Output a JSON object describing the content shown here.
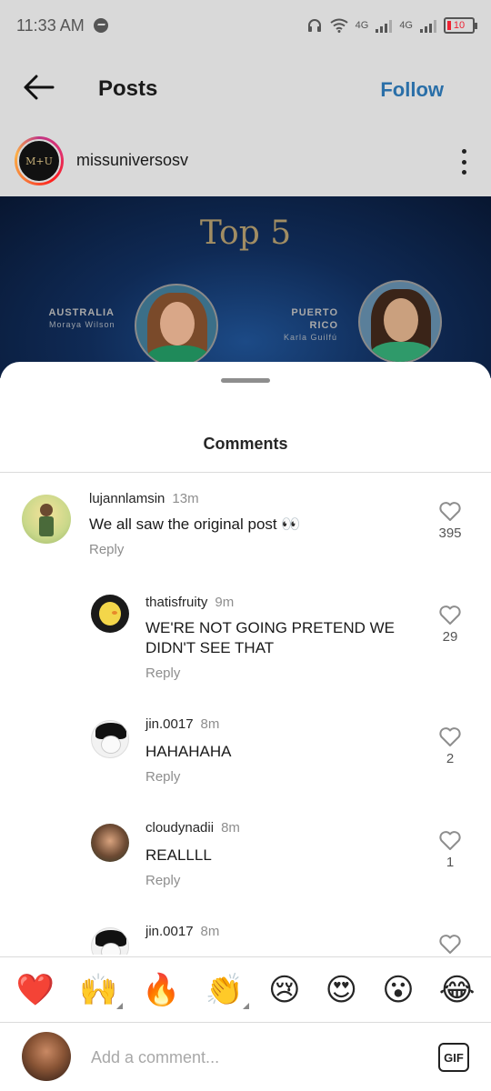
{
  "status_bar": {
    "time": "11:33 AM",
    "network1": "4G",
    "network2": "4G",
    "battery": "10"
  },
  "header": {
    "title": "Posts",
    "follow_label": "Follow"
  },
  "post": {
    "username": "missuniversosv",
    "avatar_text": "M+U",
    "image": {
      "title": "Top 5",
      "left_country": "AUSTRALIA",
      "left_name": "Moraya Wilson",
      "right_country_line1": "PUERTO",
      "right_country_line2": "RICO",
      "right_name": "Karla Guilfú"
    }
  },
  "comments_sheet": {
    "title": "Comments",
    "comments": [
      {
        "user": "lujannlamsin",
        "time": "13m",
        "text": "We all saw the original post 👀",
        "reply_label": "Reply",
        "likes": "395"
      },
      {
        "user": "thatisfruity",
        "time": "9m",
        "text_line1": "WE'RE NOT GOING PRETEND WE",
        "text_line2": "DIDN'T SEE THAT",
        "reply_label": "Reply",
        "likes": "29"
      },
      {
        "user": "jin.0017",
        "time": "8m",
        "text": "HAHAHAHA",
        "reply_label": "Reply",
        "likes": "2"
      },
      {
        "user": "cloudynadii",
        "time": "8m",
        "text": "REALLLL",
        "reply_label": "Reply",
        "likes": "1"
      },
      {
        "user": "jin.0017",
        "time": "8m"
      }
    ]
  },
  "emoji_bar": [
    "❤️",
    "🙌",
    "🔥",
    "👏",
    "😢",
    "😍",
    "😮",
    "😂"
  ],
  "add_comment": {
    "placeholder": "Add a comment...",
    "gif_label": "GIF"
  },
  "colors": {
    "follow": "#2a6fa8",
    "overlay_gray": "#d9d9d9",
    "post_bg": "#0f2a55",
    "gold": "#a18d63"
  }
}
